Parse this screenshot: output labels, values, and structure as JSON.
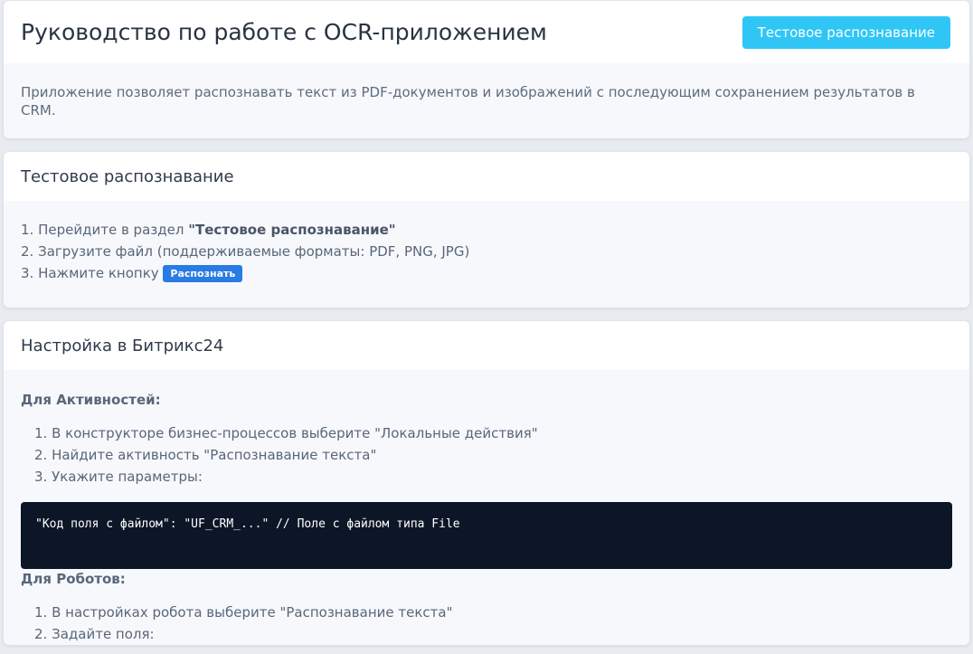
{
  "header": {
    "title": "Руководство по работе с OCR-приложением",
    "test_button": "Тестовое распознавание",
    "description": "Приложение позволяет распознавать текст из PDF-документов и изображений с последующим сохранением результатов в CRM."
  },
  "test_section": {
    "title": "Тестовое распознавание",
    "step1_prefix": "1. Перейдите в раздел ",
    "step1_bold": "\"Тестовое распознавание\"",
    "step2": "2. Загрузите файл (поддерживаемые форматы: PDF, PNG, JPG)",
    "step3_prefix": "3. Нажмите кнопку ",
    "step3_badge": "Распознать"
  },
  "bitrix_section": {
    "title": "Настройка в Битрикс24",
    "activities_label": "Для Активностей:",
    "activities_steps": [
      "1. В конструкторе бизнес-процессов выберите \"Локальные действия\"",
      "2. Найдите активность \"Распознавание текста\"",
      "3. Укажите параметры:"
    ],
    "code": "\"Код поля с файлом\": \"UF_CRM_...\" // Поле с файлом типа File",
    "robots_label": "Для Роботов:",
    "robots_steps": [
      "1. В настройках робота выберите \"Распознавание текста\"",
      "2. Задайте поля:"
    ]
  }
}
